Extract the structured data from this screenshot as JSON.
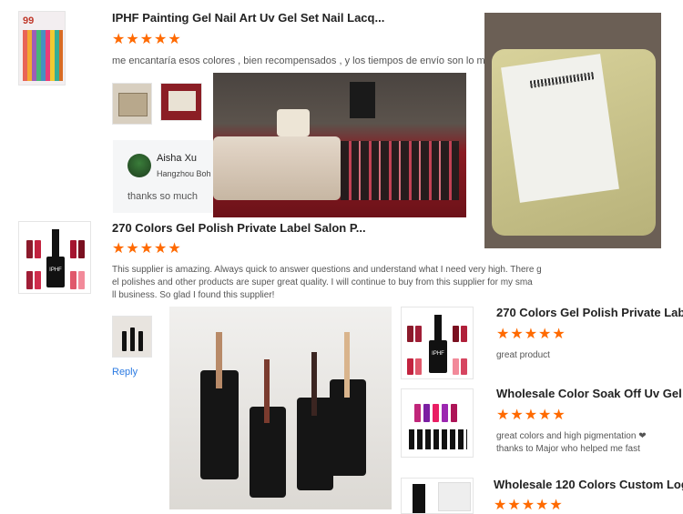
{
  "colors": {
    "star": "#ff6a00",
    "link": "#2a7ae2",
    "title": "#222222",
    "text": "#555555",
    "reply_bg": "#f5f6f7"
  },
  "review1": {
    "product_title": "IPHF Painting Gel Nail Art Uv Gel Set Nail Lacq...",
    "stars": "★★★★★",
    "text": "me encantaría esos colores , bien recompensados , y los tiempos de envío son lo m",
    "thumb_badge": "99",
    "reply": {
      "name": "Aisha Xu",
      "company": "Hangzhou Boh",
      "text": "thanks so much"
    }
  },
  "review2": {
    "product_title": "270 Colors Gel Polish Private Label Salon P...",
    "stars": "★★★★★",
    "text_lines": [
      "This supplier is amazing. Always quick to answer questions and understand what I need very high. There g",
      "el polishes and other products are super great quality. I will continue to buy from this supplier for my sma",
      "ll business. So glad I found this supplier!"
    ],
    "reply_link": "Reply",
    "thumb_brand": "IPHF"
  },
  "right_list": [
    {
      "title": "270 Colors Gel Polish Private Lab",
      "stars": "★★★★★",
      "text_lines": [
        "great product"
      ],
      "brand": "IPHF"
    },
    {
      "title": "Wholesale Color Soak Off Uv Gel",
      "stars": "★★★★★",
      "text_lines": [
        "great colors and high pigmentation ❤",
        "thanks to Major who helped me fast"
      ]
    },
    {
      "title": "Wholesale 120 Colors Custom Log",
      "stars": "★★★★★",
      "text_lines": []
    }
  ]
}
